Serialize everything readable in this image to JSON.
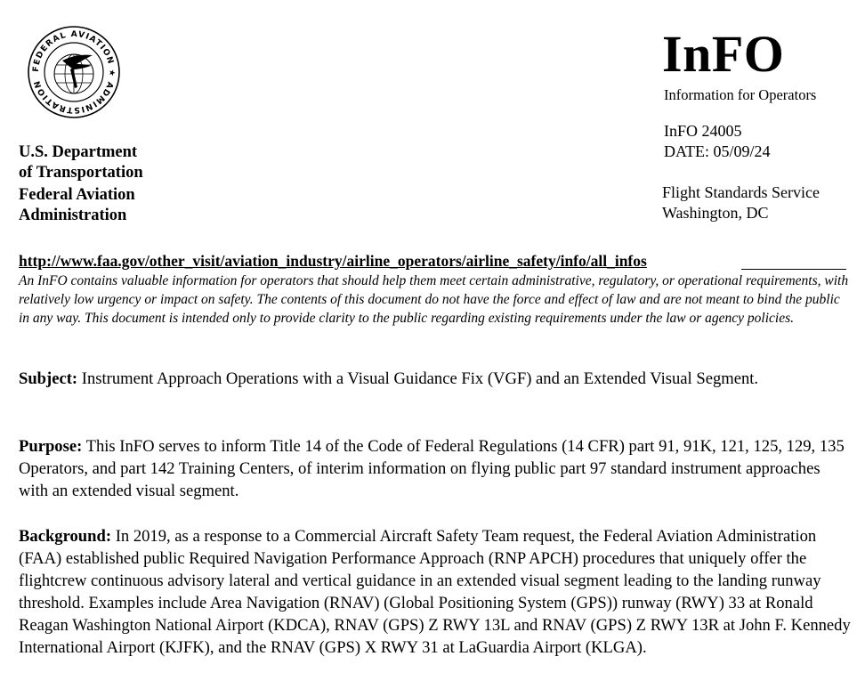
{
  "header": {
    "seal_text": "FEDERAL AVIATION ADMINISTRATION",
    "dept_line1": "U.S. Department",
    "dept_line2": "of Transportation",
    "agency_line1": "Federal Aviation",
    "agency_line2": "Administration",
    "title": "InFO",
    "subtitle": "Information for Operators",
    "info_number": "InFO 24005",
    "date": "DATE: 05/09/24",
    "office_line1": "Flight Standards Service",
    "office_line2": "Washington, DC"
  },
  "link": {
    "url_text": "http://www.faa.gov/other_visit/aviation_industry/airline_operators/airline_safety/info/all_infos"
  },
  "disclaimer": "An InFO contains valuable information for operators that should help them meet certain administrative, regulatory, or operational requirements, with relatively low urgency or impact on safety. The contents of this document do not have the force and effect of law and are not meant to bind the public in any way. This document is intended only to provide clarity to the public regarding existing requirements under the law or agency policies.",
  "sections": {
    "subject_label": "Subject:",
    "subject_text": "Instrument Approach Operations with a Visual Guidance Fix (VGF) and an Extended Visual Segment.",
    "purpose_label": "Purpose:",
    "purpose_text": "This InFO serves to inform Title 14 of the Code of Federal Regulations (14 CFR) part 91, 91K, 121, 125, 129, 135 Operators, and part 142 Training Centers, of interim information on flying public part 97 standard instrument approaches with an extended visual segment.",
    "background_label": "Background:",
    "background_text": "In 2019, as a response to a Commercial Aircraft Safety Team request, the Federal Aviation Administration (FAA) established public Required Navigation Performance Approach (RNP APCH) procedures that uniquely offer the flightcrew continuous advisory lateral and vertical guidance in an extended visual segment leading to the landing runway threshold. Examples include Area Navigation (RNAV) (Global Positioning System (GPS)) runway (RWY) 33 at Ronald Reagan Washington National Airport (KDCA), RNAV (GPS) Z RWY 13L and RNAV (GPS) Z RWY 13R at John F. Kennedy International Airport (KJFK), and the RNAV (GPS) X RWY 31 at LaGuardia Airport (KLGA)."
  }
}
